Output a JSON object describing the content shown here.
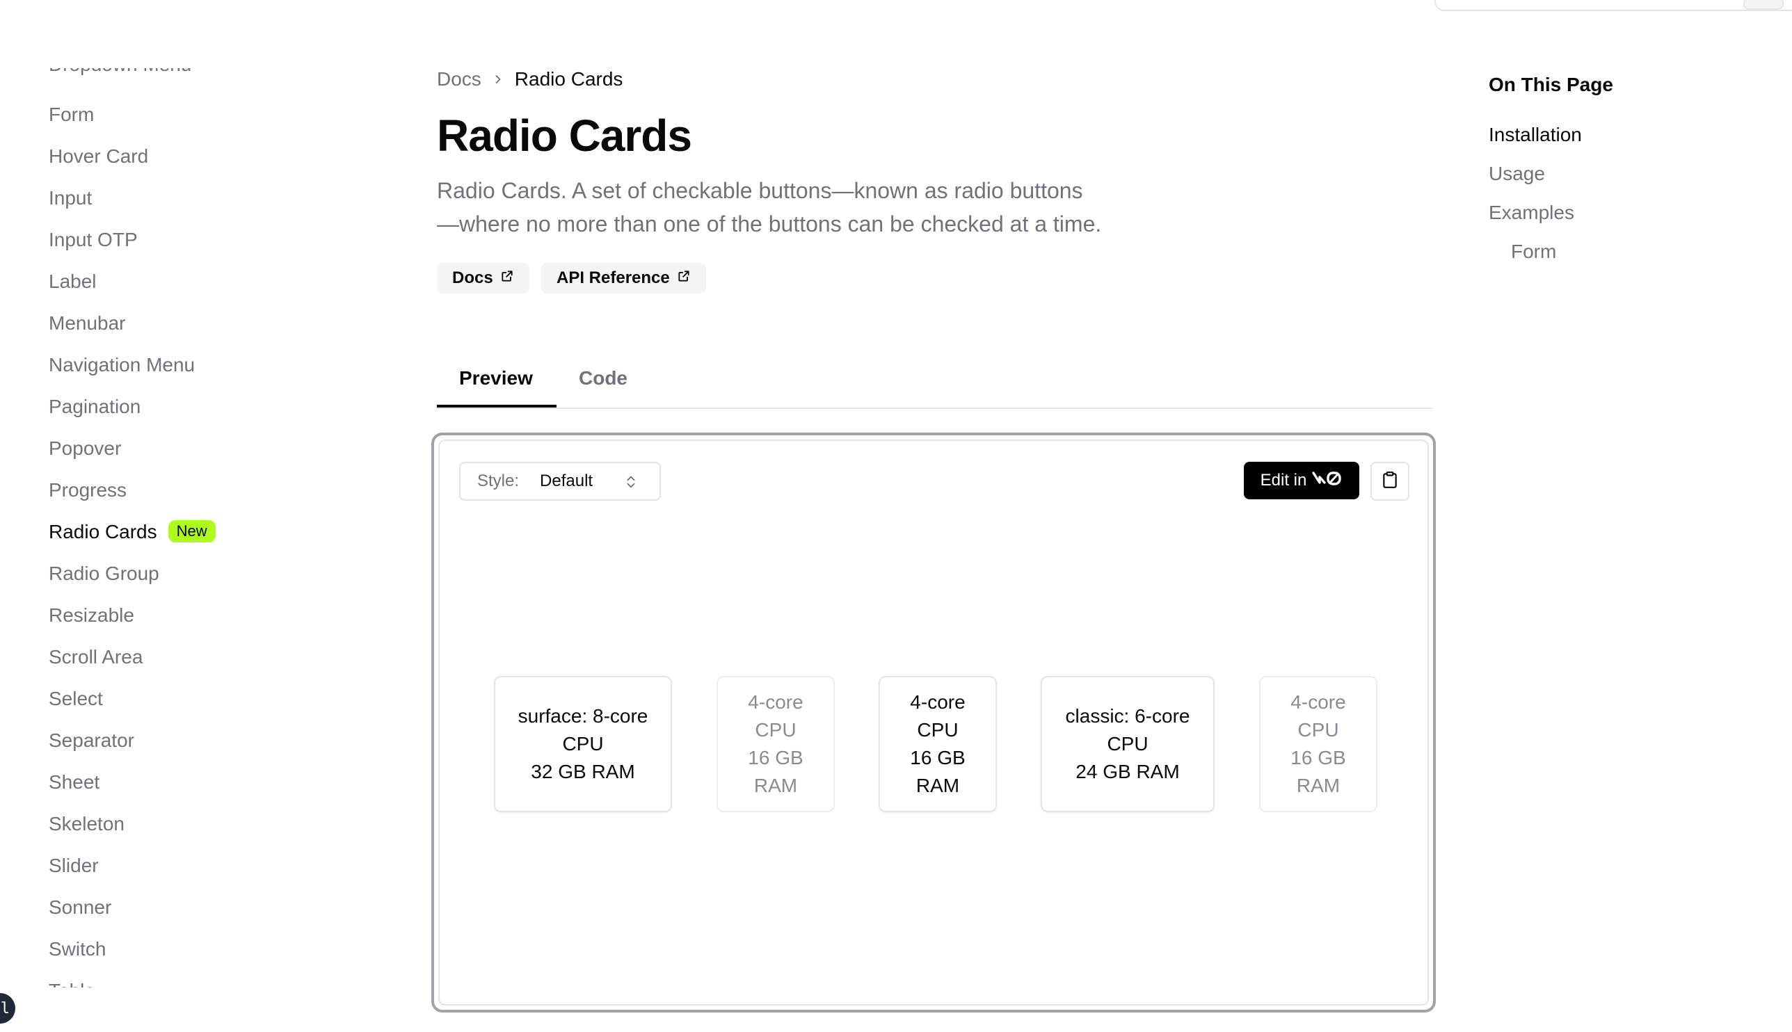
{
  "sidebar": {
    "items": [
      {
        "label": "Dropdown Menu"
      },
      {
        "label": "Form"
      },
      {
        "label": "Hover Card"
      },
      {
        "label": "Input"
      },
      {
        "label": "Input OTP"
      },
      {
        "label": "Label"
      },
      {
        "label": "Menubar"
      },
      {
        "label": "Navigation Menu"
      },
      {
        "label": "Pagination"
      },
      {
        "label": "Popover"
      },
      {
        "label": "Progress"
      },
      {
        "label": "Radio Cards",
        "badge": "New",
        "active": true
      },
      {
        "label": "Radio Group"
      },
      {
        "label": "Resizable"
      },
      {
        "label": "Scroll Area"
      },
      {
        "label": "Select"
      },
      {
        "label": "Separator"
      },
      {
        "label": "Sheet"
      },
      {
        "label": "Skeleton"
      },
      {
        "label": "Slider"
      },
      {
        "label": "Sonner"
      },
      {
        "label": "Switch"
      },
      {
        "label": "Table"
      }
    ]
  },
  "breadcrumb": {
    "root": "Docs",
    "current": "Radio Cards"
  },
  "page": {
    "title": "Radio Cards",
    "description_line1": "Radio Cards. A set of checkable buttons—known as radio buttons",
    "description_line2": "—where no more than one of the buttons can be checked at a time."
  },
  "links": {
    "docs": "Docs",
    "api_reference": "API Reference"
  },
  "tabs": {
    "preview": "Preview",
    "code": "Code"
  },
  "toolbar": {
    "style_label": "Style:",
    "style_value": "Default",
    "edit_label": "Edit in",
    "edit_logo": "v0"
  },
  "cards": [
    {
      "lines": [
        "surface: 8-core",
        "CPU",
        "32 GB RAM"
      ],
      "disabled": false
    },
    {
      "lines": [
        "4-core",
        "CPU",
        "16 GB",
        "RAM"
      ],
      "disabled": true
    },
    {
      "lines": [
        "4-core",
        "CPU",
        "16 GB",
        "RAM"
      ],
      "disabled": false
    },
    {
      "lines": [
        "classic: 6-core",
        "CPU",
        "24 GB RAM"
      ],
      "disabled": false
    },
    {
      "lines": [
        "4-core",
        "CPU",
        "16 GB",
        "RAM"
      ],
      "disabled": true
    }
  ],
  "toc": {
    "title": "On This Page",
    "items": [
      {
        "label": "Installation",
        "active": true
      },
      {
        "label": "Usage"
      },
      {
        "label": "Examples"
      },
      {
        "label": "Form",
        "nested": true
      }
    ]
  },
  "colors": {
    "accent_badge": "#adfa1d",
    "text_primary": "#09090b",
    "text_muted": "#71717a",
    "border": "#e4e4e7"
  }
}
